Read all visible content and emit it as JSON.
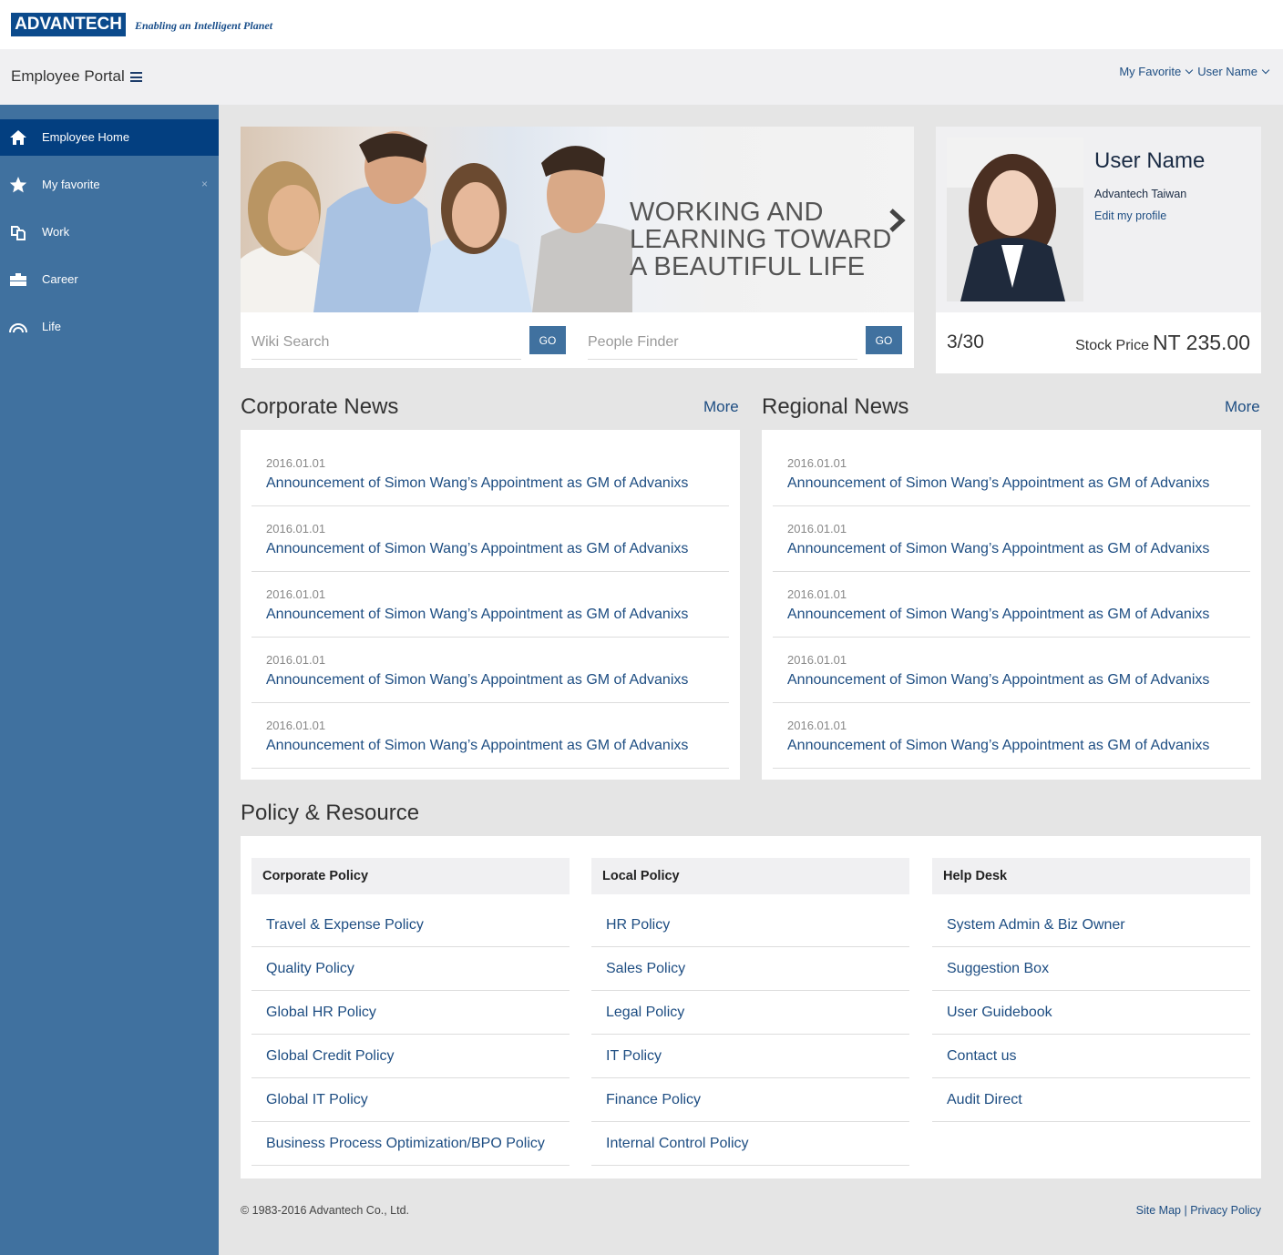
{
  "brand": {
    "logo_text": "ADVANTECH",
    "tagline": "Enabling an Intelligent Planet",
    "color": "#0b4a8c"
  },
  "header": {
    "title": "Employee Portal",
    "menu_icon": "hamburger-icon",
    "links": [
      {
        "label": "My Favorite",
        "icon": "chevron-down-icon"
      },
      {
        "label": "User Name",
        "icon": "chevron-down-icon"
      }
    ]
  },
  "sidebar": {
    "items": [
      {
        "label": "Employee Home",
        "icon": "home-icon",
        "active": true
      },
      {
        "label": "My favorite",
        "icon": "star-icon",
        "close": "×"
      },
      {
        "label": "Work",
        "icon": "copy-icon"
      },
      {
        "label": "Career",
        "icon": "briefcase-icon"
      },
      {
        "label": "Life",
        "icon": "rainbow-icon"
      }
    ]
  },
  "hero": {
    "caption_lines": [
      "WORKING AND",
      "LEARNING TOWARD",
      "A BEAUTIFUL LIFE"
    ],
    "next_icon": "chevron-right-icon"
  },
  "search": {
    "wiki": {
      "placeholder": "Wiki Search",
      "value": "",
      "button": "GO"
    },
    "people": {
      "placeholder": "People Finder",
      "value": "",
      "button": "GO"
    }
  },
  "profile": {
    "name": "User Name",
    "org": "Advantech Taiwan",
    "edit_link": "Edit my profile",
    "date": "3/30",
    "stock_label": "Stock Price",
    "stock_value": "NT 235.00"
  },
  "corporate_news": {
    "title": "Corporate News",
    "more": "More",
    "items": [
      {
        "date": "2016.01.01",
        "title": "Announcement of Simon Wang’s Appointment as GM of Advanixs"
      },
      {
        "date": "2016.01.01",
        "title": "Announcement of Simon Wang’s Appointment as GM of Advanixs"
      },
      {
        "date": "2016.01.01",
        "title": "Announcement of Simon Wang’s Appointment as GM of Advanixs"
      },
      {
        "date": "2016.01.01",
        "title": "Announcement of Simon Wang’s Appointment as GM of Advanixs"
      },
      {
        "date": "2016.01.01",
        "title": "Announcement of Simon Wang’s Appointment as GM of Advanixs"
      }
    ]
  },
  "regional_news": {
    "title": "Regional News",
    "more": "More",
    "items": [
      {
        "date": "2016.01.01",
        "title": "Announcement of Simon Wang’s Appointment as GM of Advanixs"
      },
      {
        "date": "2016.01.01",
        "title": "Announcement of Simon Wang’s Appointment as GM of Advanixs"
      },
      {
        "date": "2016.01.01",
        "title": "Announcement of Simon Wang’s Appointment as GM of Advanixs"
      },
      {
        "date": "2016.01.01",
        "title": "Announcement of Simon Wang’s Appointment as GM of Advanixs"
      },
      {
        "date": "2016.01.01",
        "title": "Announcement of Simon Wang’s Appointment as GM of Advanixs"
      }
    ]
  },
  "policy": {
    "title": "Policy & Resource",
    "columns": [
      {
        "heading": "Corporate Policy",
        "items": [
          "Travel & Expense Policy",
          "Quality Policy",
          "Global HR Policy",
          "Global Credit Policy",
          "Global IT Policy",
          "Business Process Optimization/BPO Policy"
        ]
      },
      {
        "heading": "Local Policy",
        "items": [
          "HR Policy",
          "Sales Policy",
          "Legal Policy",
          "IT Policy",
          "Finance Policy",
          "Internal Control Policy"
        ]
      },
      {
        "heading": "Help Desk",
        "items": [
          "System Admin & Biz Owner",
          "Suggestion Box",
          "User Guidebook",
          "Contact us",
          "Audit Direct"
        ]
      }
    ]
  },
  "footer": {
    "copyright": "© 1983-2016 Advantech Co., Ltd.",
    "links": [
      "Site Map",
      "Privacy Policy"
    ],
    "separator": "|"
  },
  "colors": {
    "sidebar": "#40719f",
    "sidebar_active": "#033f80",
    "link": "#1d4d82",
    "background": "#e5e5e5"
  }
}
